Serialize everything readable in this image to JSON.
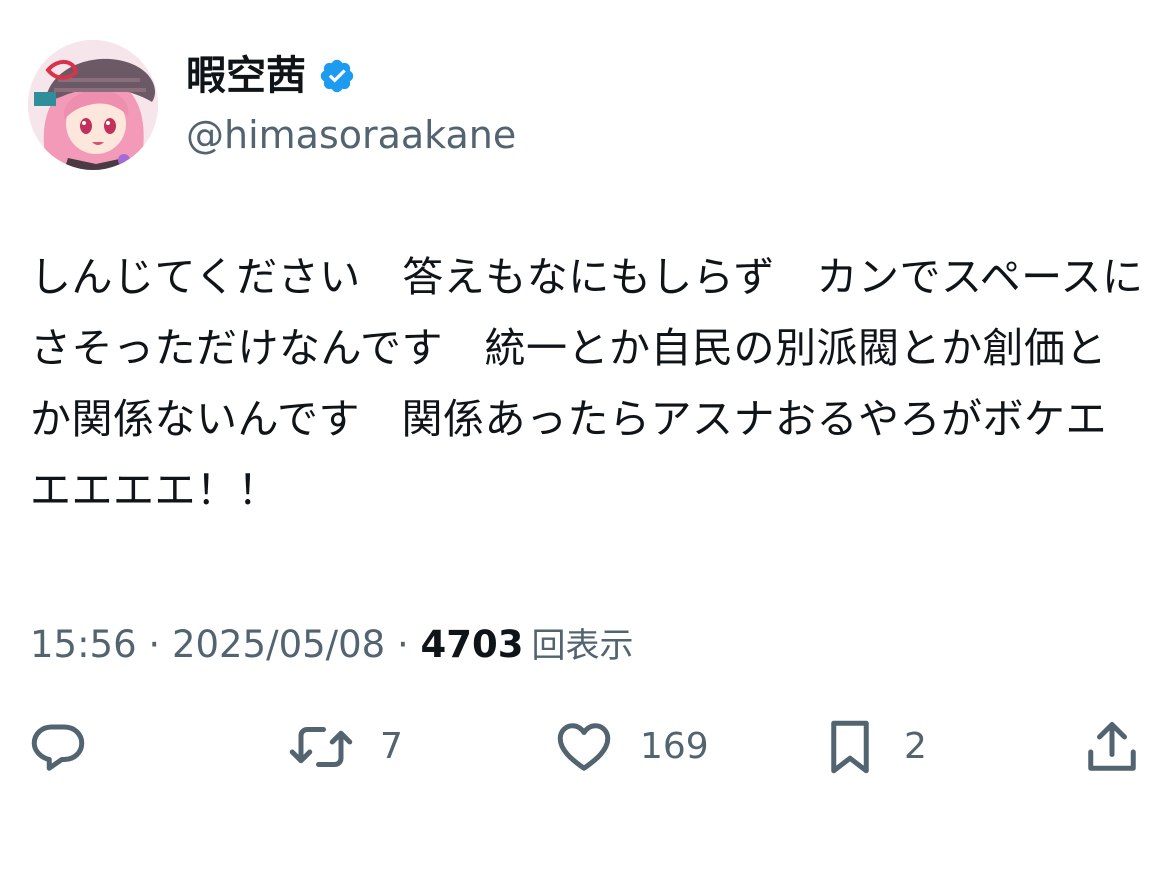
{
  "user": {
    "display_name": "暇空茜",
    "handle": "@himasoraakane",
    "verified": true,
    "verified_color": "#1d9bf0"
  },
  "tweet": {
    "text": "しんじてください　答えもなにもしらず　カンでスペースにさそっただけなんです　統一とか自民の別派閥とか創価とか関係ないんです　関係あったらアスナおるやろがボケエエエエエ！！",
    "time": "15:56",
    "separator": "·",
    "date": "2025/05/08",
    "views_count": "4703",
    "views_label": "回表示"
  },
  "actions": {
    "reply": {
      "icon": "reply-icon"
    },
    "retweet": {
      "icon": "retweet-icon",
      "count": "7"
    },
    "like": {
      "icon": "heart-icon",
      "count": "169"
    },
    "bookmark": {
      "icon": "bookmark-icon",
      "count": "2"
    },
    "share": {
      "icon": "share-icon"
    }
  },
  "colors": {
    "text_primary": "#0f1419",
    "text_secondary": "#536471",
    "background": "#ffffff"
  }
}
